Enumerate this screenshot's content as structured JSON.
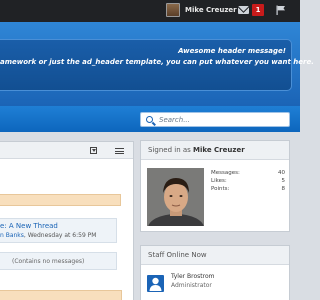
{
  "topbar": {
    "username": "Mike Creuzer",
    "notification_count": "1"
  },
  "banner": {
    "title": "Awesome header message!",
    "subtitle": "amework or just the ad_header template, you can put whatever you want here."
  },
  "search": {
    "placeholder": "Search..."
  },
  "main_panel": {
    "thread_title": "e: A New Thread",
    "thread_author": "n Banks",
    "thread_date": ", Wednesday at 6:59 PM",
    "empty_message": "(Contains no messages)"
  },
  "signed_in": {
    "prefix": "Signed in as",
    "username": "Mike Creuzer",
    "stats": [
      {
        "label": "Messages:",
        "value": "40"
      },
      {
        "label": "Likes:",
        "value": "5"
      },
      {
        "label": "Points:",
        "value": "8"
      }
    ]
  },
  "staff": {
    "heading": "Staff Online Now",
    "members": [
      {
        "name": "Tyler Brostrom",
        "role": "Administrator"
      }
    ]
  },
  "colors": {
    "topbar": "#202225",
    "brand_blue": "#1b64b6",
    "badge_red": "#c81b1b",
    "panel_highlight": "#f8dfbd"
  }
}
